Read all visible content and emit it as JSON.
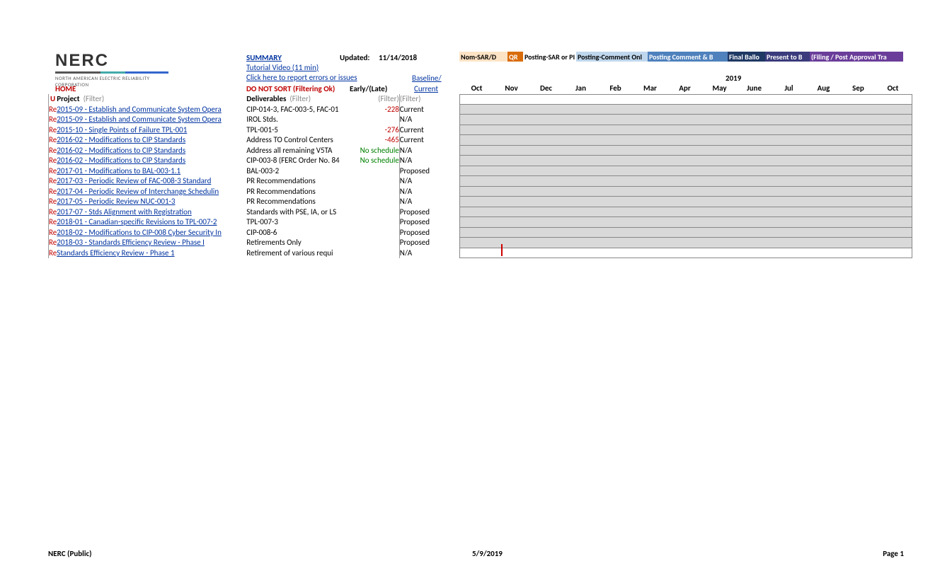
{
  "logo": {
    "title": "NERC",
    "subtitle": "NORTH AMERICAN ELECTRIC RELIABILITY CORPORATION"
  },
  "header": {
    "summary": "SUMMARY",
    "tutorial": "Tutorial Video (11 min)",
    "report_errors": "Click here to report errors or issues",
    "updated_label": "Updated:",
    "updated_date": "11/14/2018",
    "baseline": "Baseline/",
    "home": "HOME",
    "no_sort": "DO NOT SORT (Filtering Ok)",
    "early_late": "Early/(Late)",
    "current": "Current"
  },
  "columns": {
    "u": "U",
    "project": "Project",
    "filter": "(Filter)",
    "deliverables": "Deliverables"
  },
  "legend": {
    "nom": "Nom-SAR/D",
    "qr": "QR",
    "posting_sar": "Posting-SAR or PI",
    "posting_comment_only": "Posting-Comment Onl",
    "posting_comment_b": "Posting Comment & B",
    "final_ballot": "Final Ballo",
    "present": "Present to B",
    "filing": "(Filing / Post Approval Tra"
  },
  "timeline": {
    "year": "2019",
    "months": [
      "Oct",
      "Nov",
      "Dec",
      "Jan",
      "Feb",
      "Mar",
      "Apr",
      "May",
      "June",
      "Jul",
      "Aug",
      "Sep",
      "Oct"
    ]
  },
  "rows": [
    {
      "r": "Re",
      "project": "2015-09 - Establish and Communicate System Opera",
      "deliv": "CIP-014-3, FAC-003-5, FAC-01",
      "el": "-228",
      "el_class": "neg-red",
      "status": "Current"
    },
    {
      "r": "Re",
      "project": "2015-09 - Establish and Communicate System Opera",
      "deliv": "IROL Stds.",
      "el": "",
      "el_class": "",
      "status": "N/A"
    },
    {
      "r": "Re",
      "project": "2015-10 - Single Points of Failure TPL-001",
      "deliv": "TPL-001-5",
      "el": "-276",
      "el_class": "neg-red",
      "status": "Current"
    },
    {
      "r": "Re",
      "project": "2016-02 - Modifications to CIP Standards",
      "deliv": "Address TO Control Centers",
      "el": "-465",
      "el_class": "neg-red",
      "status": "Current"
    },
    {
      "r": "Re",
      "project": "2016-02 - Modifications to CIP Standards",
      "deliv": "Address all remaining V5TA",
      "el": "No schedule",
      "el_class": "no-sched",
      "status": "N/A"
    },
    {
      "r": "Re",
      "project": "2016-02 - Modifications to CIP Standards",
      "deliv": "CIP-003-8 (FERC Order No. 84",
      "el": "No schedule",
      "el_class": "no-sched",
      "status": "N/A"
    },
    {
      "r": "Re",
      "project": "2017-01 - Modifications to BAL-003-1.1",
      "deliv": "BAL-003-2",
      "el": "",
      "el_class": "",
      "status": "Proposed"
    },
    {
      "r": "Re",
      "project": "2017-03 - Periodic Review of FAC-008-3 Standard",
      "deliv": "PR Recommendations",
      "el": "",
      "el_class": "",
      "status": "N/A"
    },
    {
      "r": "Re",
      "project": "2017-04 - Periodic Review of Interchange Schedulin",
      "deliv": "PR Recommendations",
      "el": "",
      "el_class": "",
      "status": "N/A"
    },
    {
      "r": "Re",
      "project": "2017-05 - Periodic Review NUC-001-3",
      "deliv": "PR Recommendations",
      "el": "",
      "el_class": "",
      "status": "N/A"
    },
    {
      "r": "Re",
      "project": "2017-07 - Stds Alignment with Registration",
      "deliv": "Standards with PSE, IA, or LS",
      "el": "",
      "el_class": "",
      "status": "Proposed"
    },
    {
      "r": "Re",
      "project": "2018-01 - Canadian-specific Revisions to TPL-007-2",
      "deliv": "TPL-007-3",
      "el": "",
      "el_class": "",
      "status": "Proposed"
    },
    {
      "r": "Re",
      "project": "2018-02 - Modifications to CIP-008 Cyber Security In",
      "deliv": "CIP-008-6",
      "el": "",
      "el_class": "",
      "status": "Proposed"
    },
    {
      "r": "Re",
      "project": "2018-03 - Standards Efficiency Review - Phase I",
      "deliv": "Retirements Only",
      "el": "",
      "el_class": "",
      "status": "Proposed"
    },
    {
      "r": "Re",
      "project": "Standards Efficiency Review - Phase 1",
      "deliv": "Retirement of various requi",
      "el": "",
      "el_class": "",
      "status": "N/A"
    }
  ],
  "footer": {
    "left": "NERC (Public)",
    "center": "5/9/2019",
    "right": "Page 1"
  }
}
